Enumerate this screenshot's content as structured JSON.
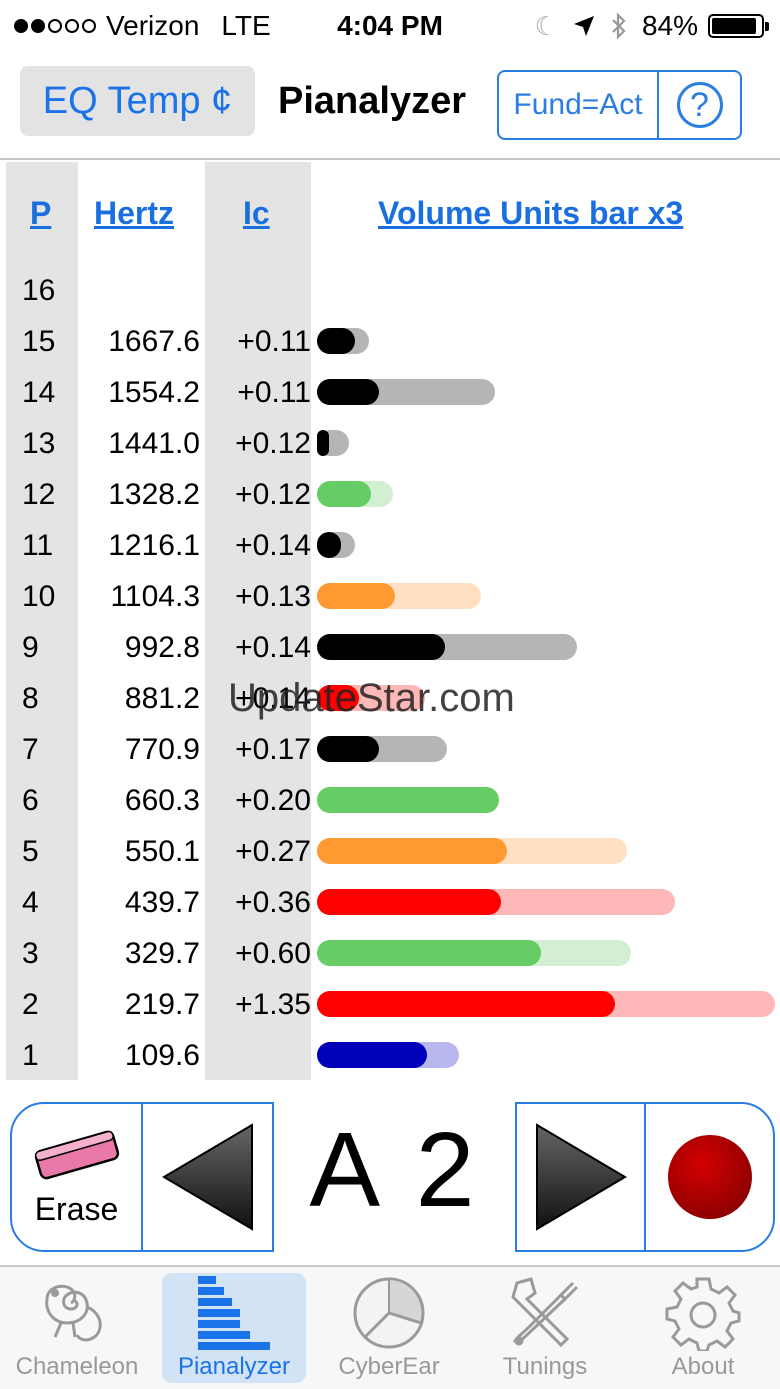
{
  "status_bar": {
    "carrier": "Verizon",
    "network": "LTE",
    "time": "4:04 PM",
    "battery": "84%",
    "battery_level": 0.84,
    "signal_bars": 2
  },
  "header": {
    "eq_button": "EQ Temp ¢",
    "title": "Pianalyzer",
    "fund_button": "Fund=Act",
    "help_button": "?"
  },
  "table": {
    "columns": [
      "P",
      "Hertz",
      "Ic",
      "Volume Units bar x3"
    ],
    "rows": [
      {
        "p": "16",
        "hz": "",
        "ic": "",
        "fill": 0,
        "track": 0,
        "color": "#000000",
        "track_color": "#b5b5b5"
      },
      {
        "p": "15",
        "hz": "1667.6",
        "ic": "+0.11",
        "fill": 38,
        "track": 52,
        "color": "#000000",
        "track_color": "#b5b5b5"
      },
      {
        "p": "14",
        "hz": "1554.2",
        "ic": "+0.11",
        "fill": 62,
        "track": 178,
        "color": "#000000",
        "track_color": "#b5b5b5"
      },
      {
        "p": "13",
        "hz": "1441.0",
        "ic": "+0.12",
        "fill": 12,
        "track": 32,
        "color": "#000000",
        "track_color": "#b5b5b5"
      },
      {
        "p": "12",
        "hz": "1328.2",
        "ic": "+0.12",
        "fill": 54,
        "track": 76,
        "color": "#66cc66",
        "track_color": "#d3efd3"
      },
      {
        "p": "11",
        "hz": "1216.1",
        "ic": "+0.14",
        "fill": 24,
        "track": 38,
        "color": "#000000",
        "track_color": "#b5b5b5"
      },
      {
        "p": "10",
        "hz": "1104.3",
        "ic": "+0.13",
        "fill": 78,
        "track": 164,
        "color": "#ff9a33",
        "track_color": "#ffe0c2"
      },
      {
        "p": "9",
        "hz": "992.8",
        "ic": "+0.14",
        "fill": 128,
        "track": 260,
        "color": "#000000",
        "track_color": "#b5b5b5"
      },
      {
        "p": "8",
        "hz": "881.2",
        "ic": "+0.14",
        "fill": 42,
        "track": 108,
        "color": "#ff0000",
        "track_color": "#ffb8b8"
      },
      {
        "p": "7",
        "hz": "770.9",
        "ic": "+0.17",
        "fill": 62,
        "track": 130,
        "color": "#000000",
        "track_color": "#b5b5b5"
      },
      {
        "p": "6",
        "hz": "660.3",
        "ic": "+0.20",
        "fill": 182,
        "track": 155,
        "color": "#66cc66",
        "track_color": "#d3efd3"
      },
      {
        "p": "5",
        "hz": "550.1",
        "ic": "+0.27",
        "fill": 190,
        "track": 310,
        "color": "#ff9a33",
        "track_color": "#ffe0c2"
      },
      {
        "p": "4",
        "hz": "439.7",
        "ic": "+0.36",
        "fill": 184,
        "track": 358,
        "color": "#ff0000",
        "track_color": "#ffb8b8"
      },
      {
        "p": "3",
        "hz": "329.7",
        "ic": "+0.60",
        "fill": 224,
        "track": 314,
        "color": "#66cc66",
        "track_color": "#d3efd3"
      },
      {
        "p": "2",
        "hz": "219.7",
        "ic": "+1.35",
        "fill": 298,
        "track": 458,
        "color": "#ff0000",
        "track_color": "#ffb8b8"
      },
      {
        "p": "1",
        "hz": "109.6",
        "ic": "",
        "fill": 110,
        "track": 142,
        "color": "#0000bb",
        "track_color": "#b8b8ee"
      }
    ]
  },
  "watermark": "UpdateStar.com",
  "controls": {
    "erase_label": "Erase",
    "note": "A 2"
  },
  "tabs": [
    {
      "label": "Chameleon",
      "icon": "chameleon-icon",
      "active": false
    },
    {
      "label": "Pianalyzer",
      "icon": "bar-chart-icon",
      "active": true
    },
    {
      "label": "CyberEar",
      "icon": "pie-chart-icon",
      "active": false
    },
    {
      "label": "Tunings",
      "icon": "tools-icon",
      "active": false
    },
    {
      "label": "About",
      "icon": "gear-icon",
      "active": false
    }
  ],
  "colors": {
    "accent": "#1a73e8",
    "border_blue": "#2a7de1",
    "record": "#aa0000"
  }
}
